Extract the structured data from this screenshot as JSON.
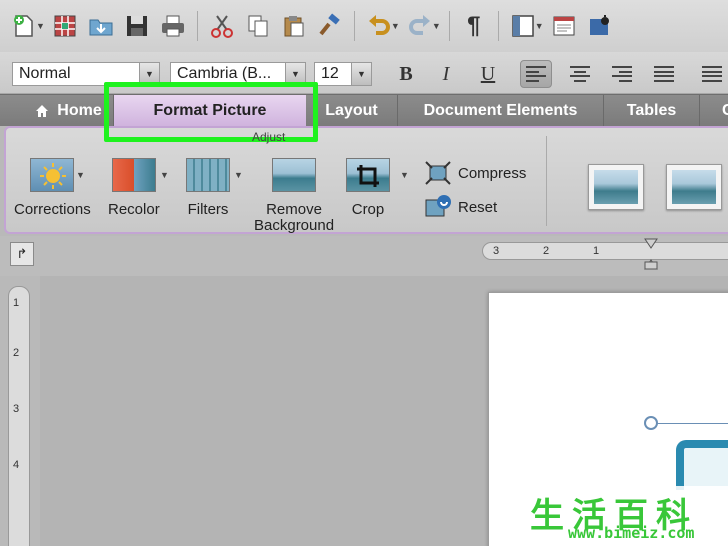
{
  "formatting": {
    "style": "Normal",
    "font": "Cambria (B...",
    "size": "12",
    "bold": "B",
    "italic": "I",
    "underline": "U"
  },
  "tabs": {
    "home": "Home",
    "format_picture": "Format Picture",
    "layout": "Layout",
    "document_elements": "Document Elements",
    "tables": "Tables",
    "more": "C"
  },
  "ribbon": {
    "group_label": "Adjust",
    "corrections": "Corrections",
    "recolor": "Recolor",
    "filters": "Filters",
    "remove_background_1": "Remove",
    "remove_background_2": "Background",
    "crop": "Crop",
    "compress": "Compress",
    "reset": "Reset"
  },
  "ruler": {
    "h_ticks": [
      "3",
      "2",
      "1"
    ],
    "v_ticks": [
      "1",
      "2",
      "3",
      "4"
    ]
  },
  "toolbar": {
    "pilcrow": "¶"
  },
  "watermark": {
    "chinese": "生活百科",
    "url": "www.bimeiz.com"
  },
  "colors": {
    "highlight": "#1ef21e",
    "format_picture_tab": "#e2ccec",
    "ribbon_border": "#c3a4d4"
  }
}
